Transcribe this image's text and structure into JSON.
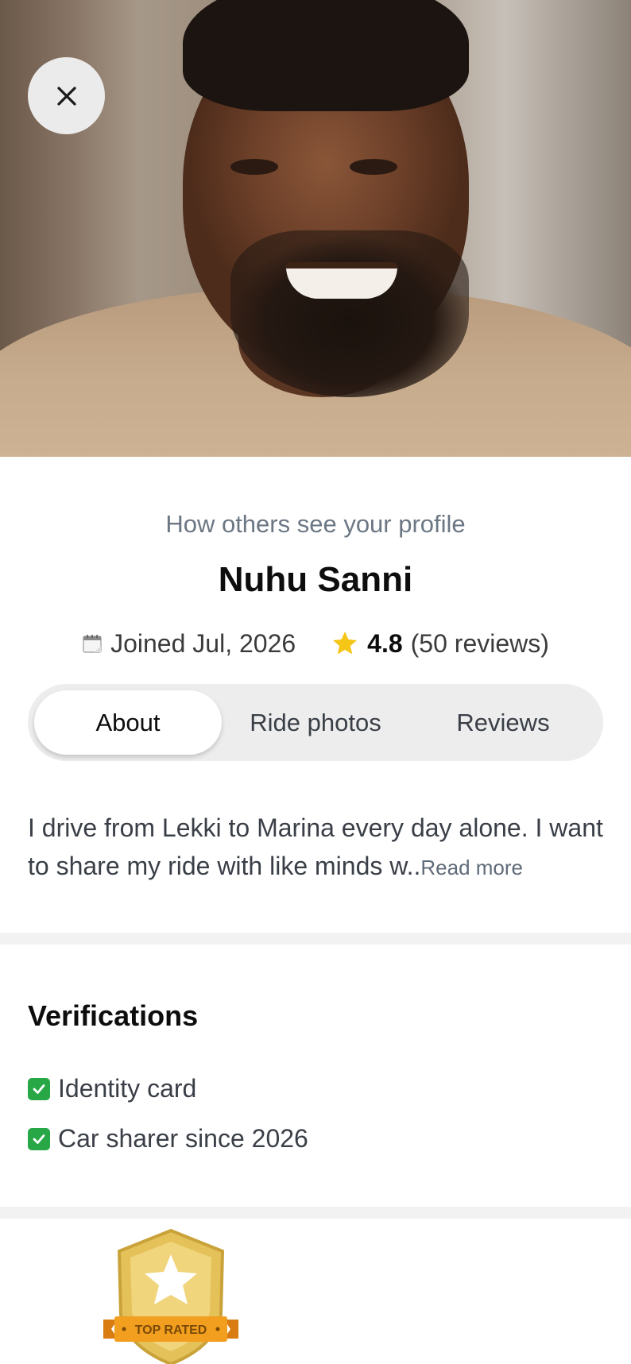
{
  "header": {
    "close_icon": "close-icon"
  },
  "profile": {
    "intro_label": "How others see your profile",
    "name": "Nuhu Sanni",
    "joined_icon": "calendar-icon",
    "joined": "Joined Jul, 2026",
    "rating_icon": "star-icon",
    "rating": "4.8",
    "reviews": "(50 reviews)"
  },
  "tabs": [
    {
      "label": "About",
      "active": true
    },
    {
      "label": "Ride photos",
      "active": false
    },
    {
      "label": "Reviews",
      "active": false
    }
  ],
  "about": {
    "bio": "I drive from Lekki to Marina every day alone. I want to share my ride with like minds w..",
    "read_more": "Read more"
  },
  "verifications": {
    "title": "Verifications",
    "items": [
      {
        "label": "Identity card",
        "icon": "check-icon"
      },
      {
        "label": "Car sharer since 2026",
        "icon": "check-icon"
      }
    ]
  },
  "badge": {
    "label": "TOP RATED",
    "icon": "shield-star-icon"
  },
  "colors": {
    "star": "#f5c518",
    "check": "#27a745",
    "badge_gold": "#e5c15a",
    "badge_ribbon": "#f29e1f"
  }
}
